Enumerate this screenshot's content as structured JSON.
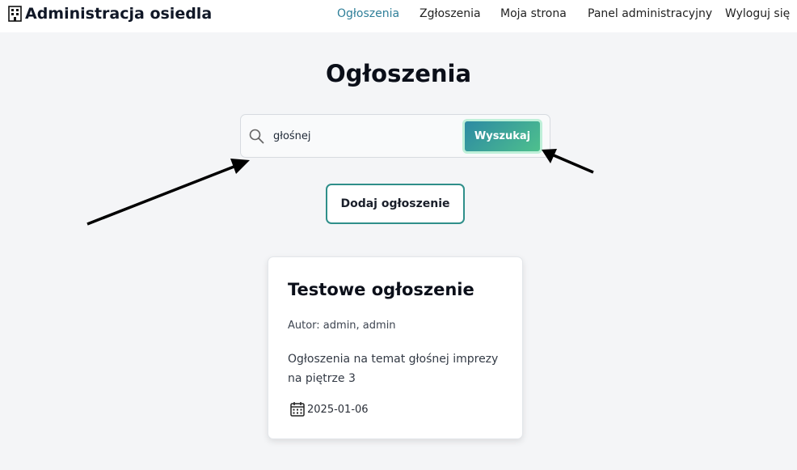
{
  "header": {
    "brand_icon": "building-icon",
    "brand_title": "Administracja osiedla",
    "nav": [
      {
        "label": "Ogłoszenia",
        "active": true
      },
      {
        "label": "Zgłoszenia",
        "active": false
      },
      {
        "label": "Moja strona",
        "active": false
      },
      {
        "label": "Panel administracyjny",
        "active": false
      },
      {
        "label": "Wyloguj się",
        "active": false
      }
    ]
  },
  "page": {
    "title": "Ogłoszenia"
  },
  "search": {
    "icon": "search-icon",
    "value": "głośnej",
    "button_label": "Wyszukaj"
  },
  "actions": {
    "add_label": "Dodaj ogłoszenie"
  },
  "announcements": [
    {
      "title": "Testowe ogłoszenie",
      "author": "Autor: admin, admin",
      "content": "Ogłoszenia na temat głośnej imprezy na piętrze 3",
      "date_icon": "calendar-icon",
      "date": "2025-01-06"
    }
  ],
  "colors": {
    "accent": "#2f7f99",
    "button_gradient_start": "#2d8aa3",
    "button_gradient_end": "#4ec08d",
    "outline": "#2f8f8a",
    "background": "#f4f5f7"
  }
}
